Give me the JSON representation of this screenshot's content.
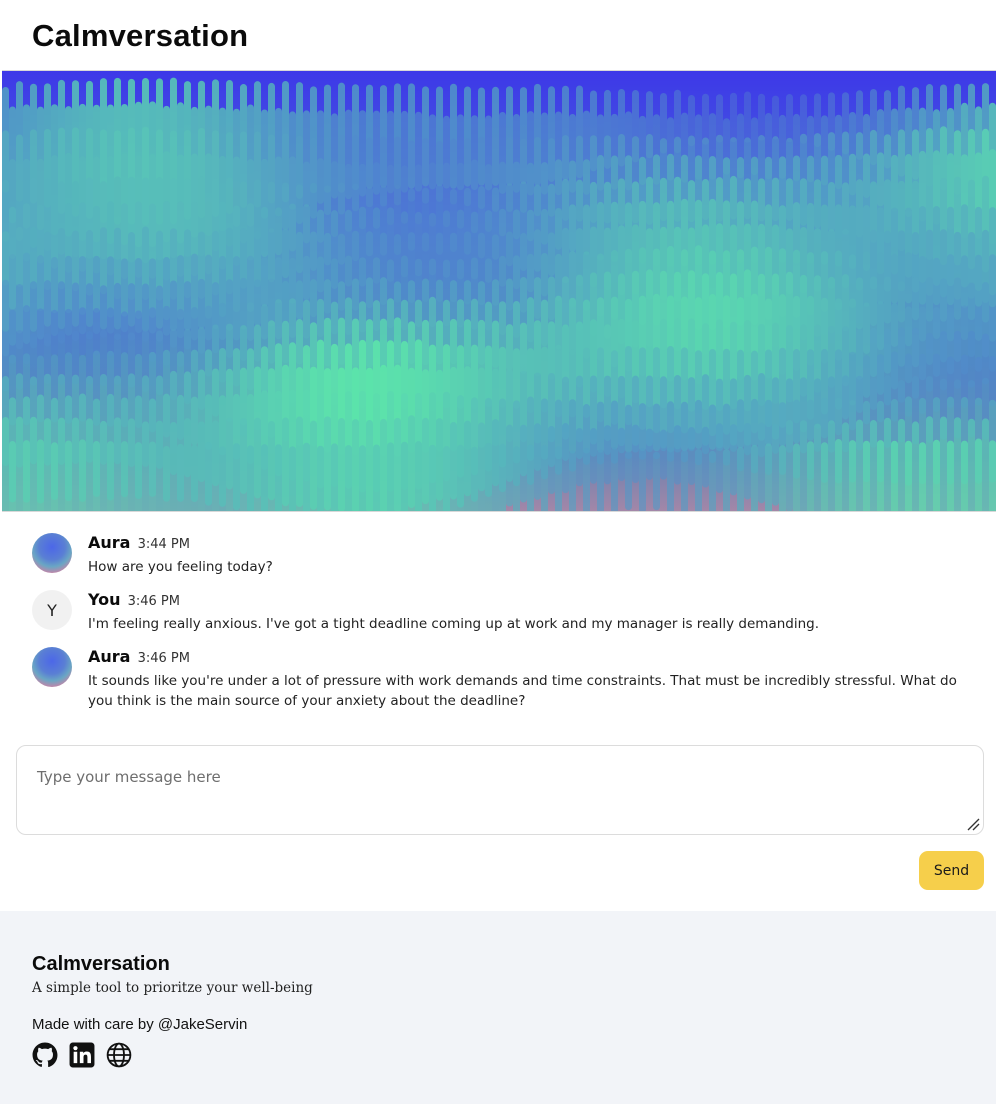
{
  "header": {
    "title": "Calmversation"
  },
  "messages": [
    {
      "sender": "Aura",
      "time": "3:44 PM",
      "text": "How are you feeling today?",
      "avatar": "aura-avatar"
    },
    {
      "sender": "You",
      "time": "3:46 PM",
      "text": "I'm feeling really anxious. I've got a tight deadline coming up at work and my manager is really demanding.",
      "avatar_letter": "Y"
    },
    {
      "sender": "Aura",
      "time": "3:46 PM",
      "text": "It sounds like you're under a lot of pressure with work demands and time constraints. That must be incredibly stressful. What do you think is the main source of your anxiety about the deadline?",
      "avatar": "aura-avatar"
    }
  ],
  "composer": {
    "placeholder": "Type your message here",
    "value": ""
  },
  "send_label": "Send",
  "footer": {
    "title": "Calmversation",
    "tagline": "A simple tool to prioritze your well-being",
    "credit": "Made with care by @JakeServin",
    "socials": [
      "github-icon",
      "linkedin-icon",
      "globe-icon"
    ]
  },
  "colors": {
    "accent": "#f6cf4b",
    "footer_bg": "#f2f4f8",
    "hero_top": "#3e3ee6",
    "hero_mid": "#4c8cc6",
    "hero_bottom": "#9c88a8"
  }
}
